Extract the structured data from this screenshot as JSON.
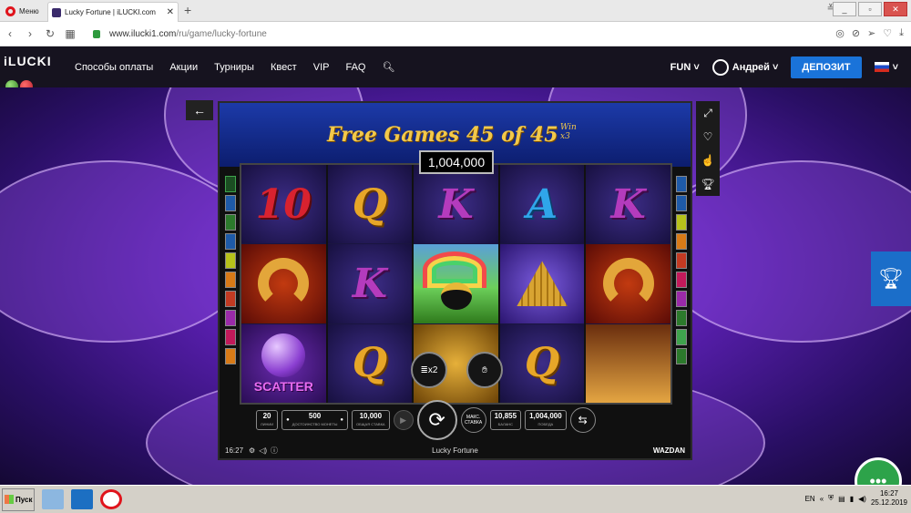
{
  "browser": {
    "menu_label": "Меню",
    "tab_title": "Lucky Fortune | iLUCKI.com",
    "tab_close": "✕",
    "new_tab": "+",
    "url_host": "www.ilucki1.com",
    "url_path": "/ru/game/lucky-fortune"
  },
  "site": {
    "logo": "iLUCKI",
    "nav": [
      "Способы оплаты",
      "Акции",
      "Турниры",
      "Квест",
      "VIP",
      "FAQ"
    ],
    "mode": "FUN",
    "user": "Андрей",
    "deposit": "ДЕПОЗИТ"
  },
  "game": {
    "title": "Free Games 45 of 45",
    "win_label": "Win",
    "multiplier": "x3",
    "win_amount": "1,004,000",
    "reels": [
      [
        {
          "t": "10",
          "c": "c-red"
        },
        {
          "t": "",
          "c": "shoe"
        },
        {
          "t": "SCATTER",
          "c": "scatter"
        }
      ],
      [
        {
          "t": "Q",
          "c": "c-gold"
        },
        {
          "t": "K",
          "c": "c-purple"
        },
        {
          "t": "Q",
          "c": "c-gold"
        }
      ],
      [
        {
          "t": "K",
          "c": "c-purple"
        },
        {
          "t": "",
          "c": "pot"
        },
        {
          "t": "",
          "c": "goldbg"
        }
      ],
      [
        {
          "t": "A",
          "c": "c-blue"
        },
        {
          "t": "",
          "c": "coins"
        },
        {
          "t": "Q",
          "c": "c-gold"
        }
      ],
      [
        {
          "t": "K",
          "c": "c-purple"
        },
        {
          "t": "",
          "c": "shoe"
        },
        {
          "t": "",
          "c": "champ"
        }
      ]
    ],
    "lines": "20",
    "lines_label": "ЛИНИИ",
    "coin_value": "500",
    "coin_label": "ДОСТОИНСТВО МОНЕТЫ",
    "total_bet": "10,000",
    "total_bet_label": "ОБЩАЯ СТАВКА",
    "max_bet": "МАКС. СТАВКА",
    "balance": "10,855",
    "balance_label": "БАЛАНС",
    "win": "1,004,000",
    "win_label_ctl": "ПОБЕДА",
    "x2_label": "x2",
    "time": "16:27",
    "game_name": "Lucky Fortune",
    "provider": "WAZDAN"
  },
  "taskbar": {
    "start": "Пуск",
    "lang": "EN",
    "time": "16:27",
    "date": "25.12.2019"
  },
  "colors": {
    "accent": "#1a73d9",
    "title_gold": "#f3c94a"
  }
}
